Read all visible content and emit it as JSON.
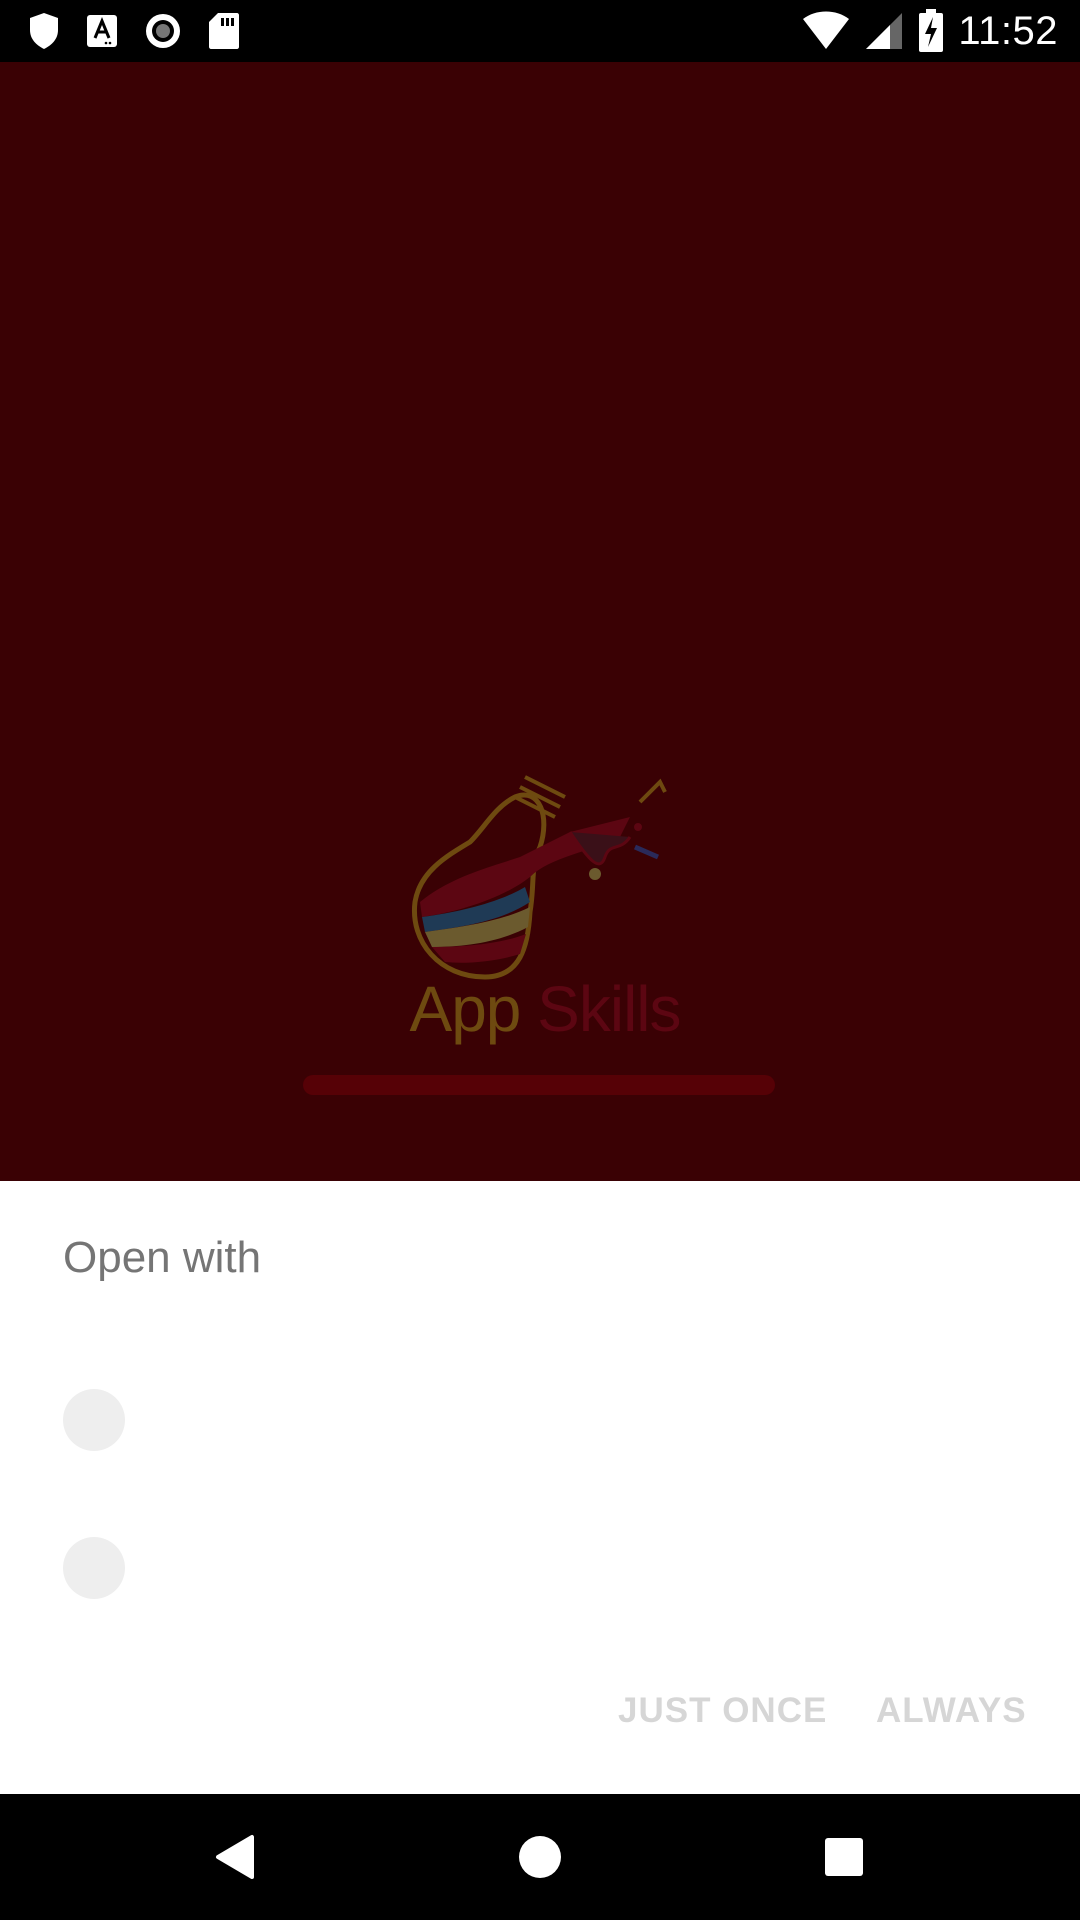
{
  "status_bar": {
    "time": "11:52",
    "left_icons": [
      "shield-icon",
      "font-a-icon",
      "record-icon",
      "sd-card-icon"
    ],
    "right_icons": [
      "wifi-icon",
      "signal-icon",
      "battery-charging-icon"
    ]
  },
  "splash": {
    "background": "#3a0104",
    "logo_word1": "App",
    "logo_word2": "Skills"
  },
  "dialog": {
    "title": "Open with",
    "app_items": [
      {
        "icon": "app-placeholder-icon"
      },
      {
        "icon": "app-placeholder-icon"
      }
    ],
    "just_once_label": "JUST ONCE",
    "always_label": "ALWAYS"
  },
  "nav_bar": {
    "buttons": [
      "back-icon",
      "home-icon",
      "recents-icon"
    ]
  }
}
